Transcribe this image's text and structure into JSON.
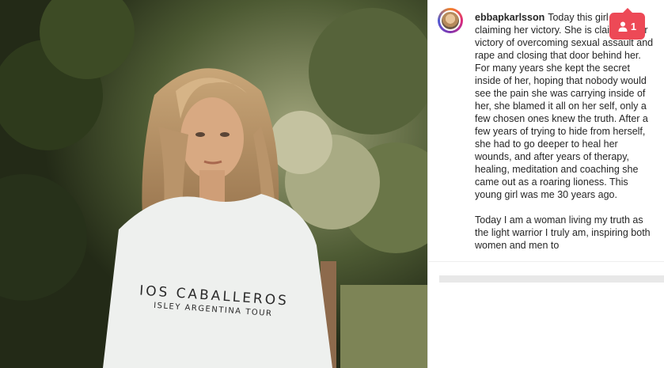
{
  "post": {
    "image_alt": "Young woman with long wavy blonde hair in a white t-shirt",
    "shirt_line1": "IOS CABALLEROS",
    "shirt_line2": "ISLEY ARGENTINA TOUR"
  },
  "caption": {
    "username": "ebbapkarlsson",
    "paragraph1": "Today this girl is claiming her victory. She is claiming her victory of overcoming sexual assault and rape and closing that door behind her. For many years she kept the secret inside of her, hoping that nobody would see the pain she was carrying inside of her, she blamed it all on her self, only a few chosen ones knew the truth. After a few years of trying to hide from herself, she had to go deeper to heal her wounds, and after years of therapy, healing, meditation and coaching she came out as a roaring lioness. This young girl was me 30 years ago.",
    "paragraph2": "Today I am a woman living my truth as the light warrior I truly am, inspiring both women and men to"
  },
  "notification": {
    "icon": "user-icon",
    "count": "1",
    "color": "#ed4956"
  }
}
